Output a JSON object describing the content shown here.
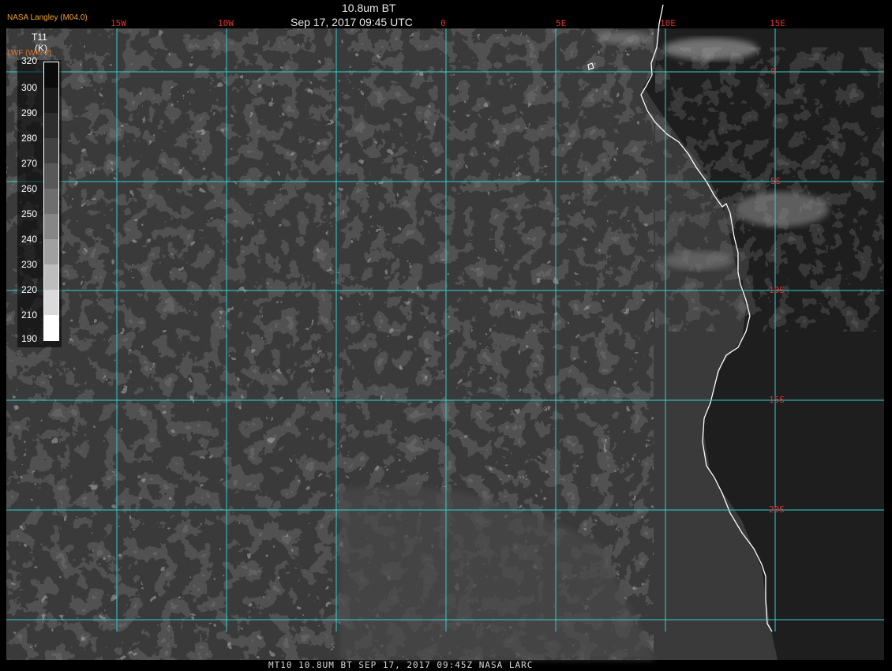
{
  "header": {
    "product": "10.8um BT",
    "datetime": "Sep 17, 2017 09:45 UTC",
    "credit": "NASA Langley (M04.0)",
    "secondary_label": "LWF (Wm-2)"
  },
  "colorbar": {
    "variable": "T11",
    "unit": "(K)",
    "ticks": [
      "320",
      "300",
      "290",
      "280",
      "270",
      "260",
      "250",
      "240",
      "230",
      "220",
      "210",
      "190"
    ]
  },
  "grid": {
    "lon_labels": [
      "15W",
      "10W",
      "0",
      "5E",
      "10E",
      "15E"
    ],
    "lat_labels": [
      "0",
      "5S",
      "10S",
      "15S",
      "20S"
    ]
  },
  "footer": {
    "caption": "MT10  10.8UM BT   SEP 17, 2017 09:45Z   NASA LARC"
  },
  "colors": {
    "grid_lines": "#30d0d0",
    "grid_labels": "#e03030",
    "coastline": "#ffffff",
    "credit": "#f0a030"
  }
}
